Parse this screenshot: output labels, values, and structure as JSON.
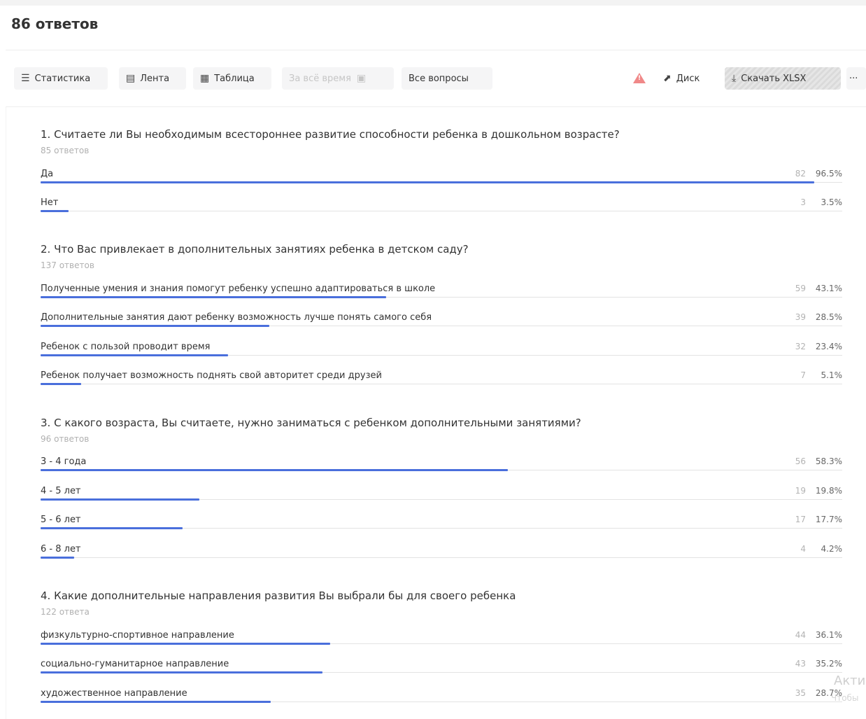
{
  "header": {
    "responses": "86 ответов"
  },
  "toolbar": {
    "stats": "Статистика",
    "feed": "Лента",
    "table": "Таблица",
    "period": "За всё время",
    "all_questions": "Все вопросы",
    "disk": "Диск",
    "download": "Скачать XLSX",
    "more": "···",
    "icons": {
      "stats": "chart-icon",
      "feed": "feed-icon",
      "table": "table-icon",
      "period": "calendar-icon",
      "warning": "warning-icon",
      "disk": "disk-icon",
      "download": "download-icon",
      "more": "more-icon"
    }
  },
  "accent_color": "#4a6fdc",
  "questions": [
    {
      "title": "1. Считаете ли Вы необходимым всестороннее развитие способности ребенка в дошкольном возрасте?",
      "count": "85 ответов",
      "options": [
        {
          "label": "Да",
          "count": "82",
          "pct": "96.5%",
          "share": 0.965
        },
        {
          "label": "Нет",
          "count": "3",
          "pct": "3.5%",
          "share": 0.035
        }
      ]
    },
    {
      "title": "2. Что Вас привлекает в дополнительных занятиях ребенка в детском саду?",
      "count": "137 ответов",
      "options": [
        {
          "label": "Полученные умения и знания помогут ребенку успешно адаптироваться в школе",
          "count": "59",
          "pct": "43.1%",
          "share": 0.431
        },
        {
          "label": "Дополнительные занятия дают ребенку возможность лучше понять самого себя",
          "count": "39",
          "pct": "28.5%",
          "share": 0.285
        },
        {
          "label": "Ребенок с пользой проводит время",
          "count": "32",
          "pct": "23.4%",
          "share": 0.234
        },
        {
          "label": "Ребенок получает возможность поднять свой авторитет среди друзей",
          "count": "7",
          "pct": "5.1%",
          "share": 0.051
        }
      ]
    },
    {
      "title": "3. С какого возраста, Вы считаете, нужно заниматься с ребенком дополнительными занятиями?",
      "count": "96 ответов",
      "options": [
        {
          "label": "3 - 4 года",
          "count": "56",
          "pct": "58.3%",
          "share": 0.583
        },
        {
          "label": "4 - 5 лет",
          "count": "19",
          "pct": "19.8%",
          "share": 0.198
        },
        {
          "label": "5 - 6 лет",
          "count": "17",
          "pct": "17.7%",
          "share": 0.177
        },
        {
          "label": "6 - 8 лет",
          "count": "4",
          "pct": "4.2%",
          "share": 0.042
        }
      ]
    },
    {
      "title": "4. Какие дополнительные направления развития Вы выбрали бы для своего ребенка",
      "count": "122 ответа",
      "options": [
        {
          "label": "физкультурно-спортивное направление",
          "count": "44",
          "pct": "36.1%",
          "share": 0.361
        },
        {
          "label": "социально-гуманитарное направление",
          "count": "43",
          "pct": "35.2%",
          "share": 0.352
        },
        {
          "label": "художественное направление",
          "count": "35",
          "pct": "28.7%",
          "share": 0.287
        }
      ]
    }
  ],
  "watermark": {
    "line1": "Акти",
    "line2": "Чтобы"
  }
}
